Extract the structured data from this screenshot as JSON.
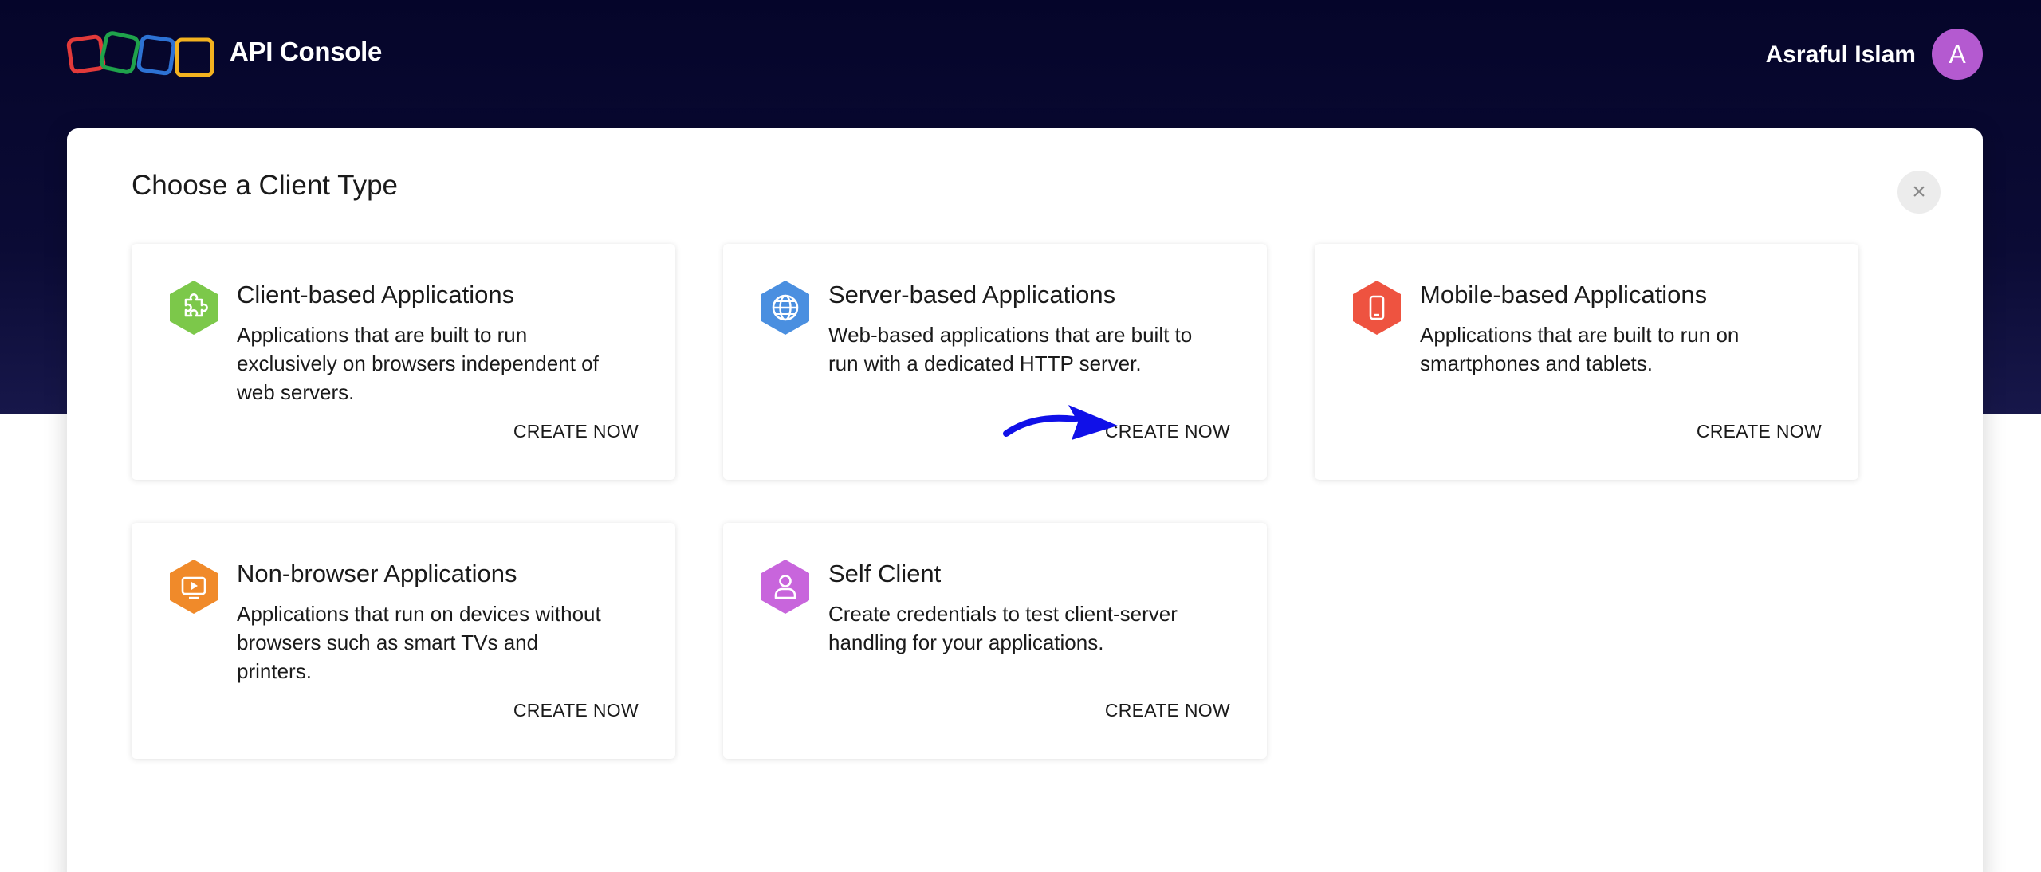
{
  "header": {
    "app_title": "API Console",
    "user_name": "Asraful Islam",
    "avatar_initial": "A"
  },
  "modal": {
    "title": "Choose a Client Type",
    "close_symbol": "×"
  },
  "cards": [
    {
      "title": "Client-based Applications",
      "description": "Applications that are built to run exclusively on browsers independent of web servers.",
      "cta": "CREATE NOW",
      "icon": "puzzle-icon",
      "color": "#7cc84a"
    },
    {
      "title": "Server-based Applications",
      "description": "Web-based applications that are built to run with a dedicated HTTP server.",
      "cta": "CREATE NOW",
      "icon": "globe-icon",
      "color": "#4a8fe0"
    },
    {
      "title": "Mobile-based Applications",
      "description": "Applications that are built to run on smartphones and tablets.",
      "cta": "CREATE NOW",
      "icon": "phone-icon",
      "color": "#ee5340"
    },
    {
      "title": "Non-browser Applications",
      "description": "Applications that run on devices without browsers such as smart TVs and printers.",
      "cta": "CREATE NOW",
      "icon": "tv-icon",
      "color": "#f08a2a"
    },
    {
      "title": "Self Client",
      "description": "Create credentials to test client-server handling for your applications.",
      "cta": "CREATE NOW",
      "icon": "user-icon",
      "color": "#c865dc"
    }
  ],
  "colors": {
    "header_bg": "#05052a",
    "annotation_arrow": "#1010e8",
    "logo": [
      "#e23a3a",
      "#1fa24b",
      "#2d72d4",
      "#f3b21f"
    ]
  }
}
